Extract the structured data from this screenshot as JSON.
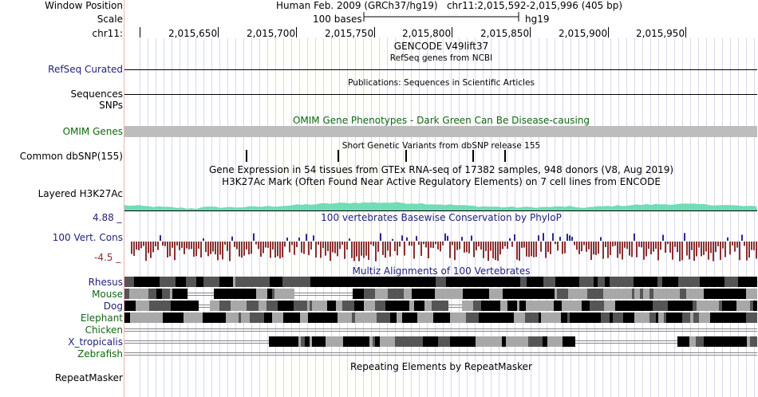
{
  "header": {
    "window_position_label": "Window Position",
    "window_position_value": "Human Feb. 2009 (GRCh37/hg19)   chr11:2,015,592-2,015,996 (405 bp)",
    "scale_label": "Scale",
    "scale_text": "100 bases",
    "scale_assembly": "hg19",
    "chrom_label": "chr11:",
    "ruler_ticks": [
      "2,015,650",
      "2,015,700",
      "2,015,750",
      "2,015,800",
      "2,015,850",
      "2,015,900",
      "2,015,950"
    ]
  },
  "tracks": {
    "gencode_title": "GENCODE V49lift37",
    "refseq_subtitle": "RefSeq genes from NCBI",
    "refseq_label": "RefSeq Curated",
    "publications_title": "Publications: Sequences in Scientific Articles",
    "sequences_label": "Sequences",
    "snps_label": "SNPs",
    "omim_title": "OMIM Gene Phenotypes - Dark Green Can Be Disease-causing",
    "omim_label": "OMIM Genes",
    "dbsnp_title": "Short Genetic Variants from dbSNP release 155",
    "dbsnp_label": "Common dbSNP(155)",
    "gtex_title": "Gene Expression in 54 tissues from GTEx RNA-seq of 17382 samples, 948 donors (V8, Aug 2019)",
    "h3k27ac_title": "H3K27Ac Mark (Often Found Near Active Regulatory Elements) on 7 cell lines from ENCODE",
    "h3k27ac_label": "Layered H3K27Ac",
    "cons_max": "4.88 _",
    "cons_title": "100 vertebrates Basewise Conservation by PhyloP",
    "cons_label": "100 Vert. Cons",
    "cons_min": "-4.5 _",
    "multiz_title": "Multiz Alignments of 100 Vertebrates",
    "species": [
      "Rhesus",
      "Mouse",
      "Dog",
      "Elephant",
      "Chicken",
      "X_tropicalis",
      "Zebrafish"
    ],
    "repeat_title": "Repeating Elements by RepeatMasker",
    "repeat_label": "RepeatMasker"
  },
  "colors": {
    "blue_label": "#1f1f7a",
    "green_label": "#116611",
    "omim_bar": "#bdbdbd",
    "h3k27ac": "#72dcb6",
    "cons_pos": "#2a2a8c",
    "cons_neg": "#8b3030",
    "grid": "#d8d8f0"
  }
}
